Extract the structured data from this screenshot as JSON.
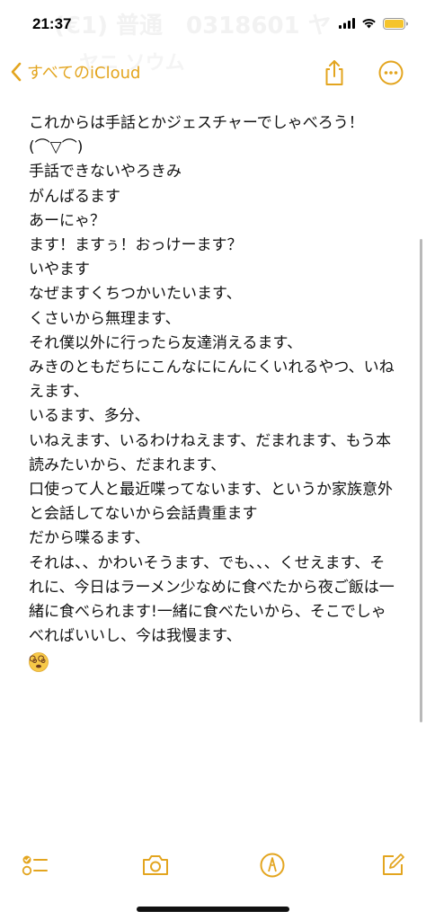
{
  "status_bar": {
    "time": "21:37",
    "ghost_line_1": "(€1) 普通　0318601 ヤ",
    "ghost_line_2": "ヤニ ソウム"
  },
  "nav": {
    "back_label": "すべてのiCloud",
    "accent_color": "#e3a51f",
    "icons": [
      "chevron-left-icon",
      "share-icon",
      "more-icon"
    ]
  },
  "note": {
    "lines": [
      "これからは手話とかジェスチャーでしゃべろう！",
      "(⌒▽⌒)",
      "手話できないやろきみ",
      "がんばるます",
      "あーにゃ？",
      "ます！ますぅ！おっけーます？",
      "いやます",
      "なぜますくちつかいたいます、",
      "くさいから無理ます、",
      "それ僕以外に行ったら友達消えるます、",
      "みきのともだちにこんなににんにくいれるやつ、いねえます、",
      "いるます、多分、",
      "いねえます、いるわけねえます、だまれます、もう本読みたいから、だまれます、",
      "口使って人と最近喋ってないます、というか家族意外と会話してないから会話貴重ます",
      "だから喋るます、",
      "それは、、かわいそうます、でも、、、くせえます、それに、今日はラーメン少なめに食べたから夜ご飯は一緒に食べられます!一緒に食べたいから、そこでしゃべればいいし、今は我慢ます、"
    ],
    "trailing_emoji": "face-with-spiral-eyes"
  },
  "toolbar": {
    "icons": [
      "checklist-icon",
      "camera-icon",
      "markup-pen-icon",
      "compose-icon"
    ]
  }
}
